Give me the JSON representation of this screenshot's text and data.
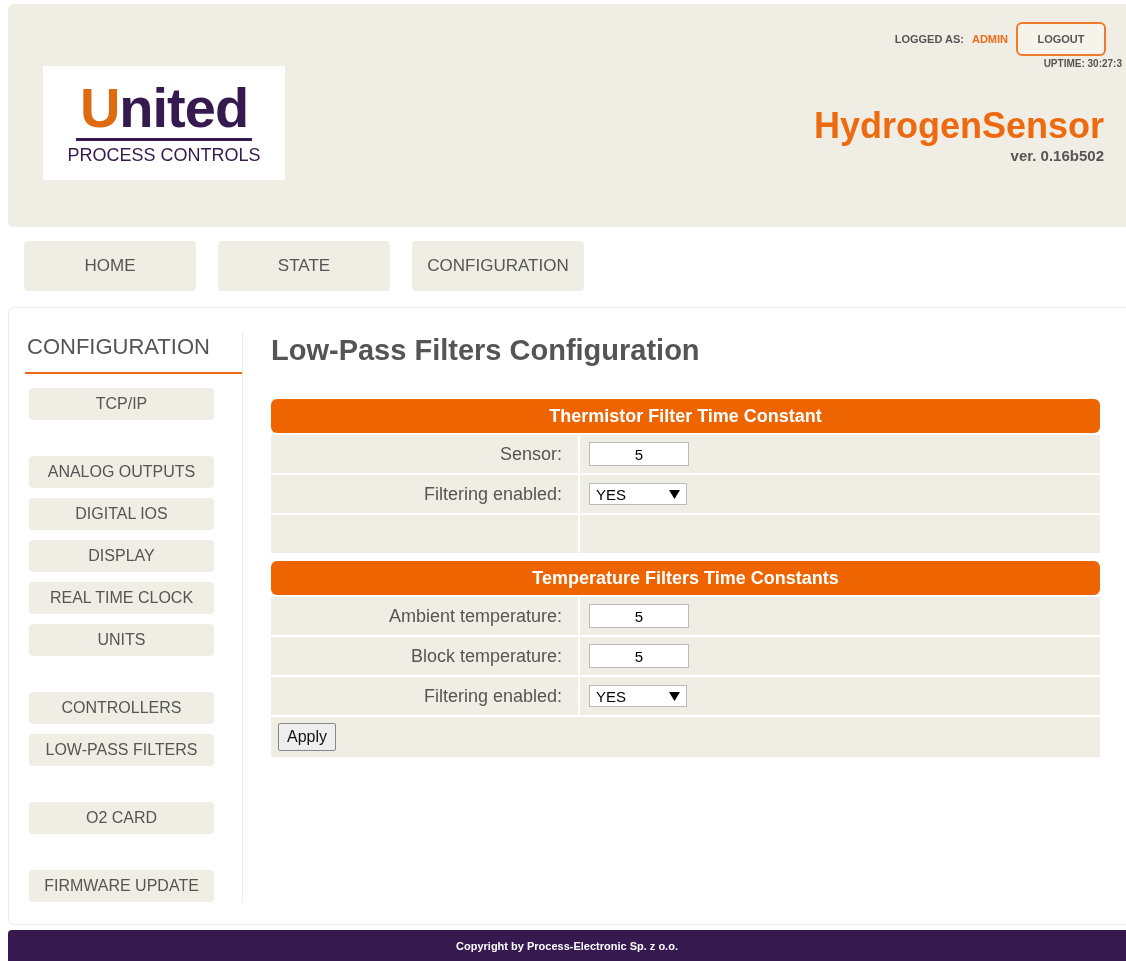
{
  "header": {
    "logo": {
      "name": "United",
      "tagline": "PROCESS CONTROLS"
    },
    "logged_label": "LOGGED AS:",
    "user": "ADMIN",
    "logout": "LOGOUT",
    "uptime": "UPTIME: 30:27:3",
    "product": "HydrogenSensor",
    "version": "ver. 0.16b502"
  },
  "nav": [
    {
      "label": "HOME"
    },
    {
      "label": "STATE"
    },
    {
      "label": "CONFIGURATION"
    }
  ],
  "sidebar": {
    "title": "CONFIGURATION",
    "groups": [
      {
        "items": [
          "TCP/IP"
        ]
      },
      {
        "items": [
          "ANALOG OUTPUTS",
          "DIGITAL IOS",
          "DISPLAY",
          "REAL TIME CLOCK",
          "UNITS"
        ]
      },
      {
        "items": [
          "CONTROLLERS",
          "LOW-PASS FILTERS"
        ]
      },
      {
        "items": [
          "O2 CARD"
        ]
      },
      {
        "items": [
          "FIRMWARE UPDATE"
        ]
      }
    ]
  },
  "title": "Low-Pass Filters Configuration",
  "sections": [
    {
      "heading": "Thermistor Filter Time Constant",
      "rows": [
        {
          "kind": "input",
          "label": "Sensor:",
          "value": "5"
        },
        {
          "kind": "select",
          "label": "Filtering enabled:",
          "value": "YES"
        },
        {
          "kind": "blank"
        }
      ]
    },
    {
      "heading": "Temperature Filters Time Constants",
      "rows": [
        {
          "kind": "input",
          "label": "Ambient temperature:",
          "value": "5"
        },
        {
          "kind": "input",
          "label": "Block temperature:",
          "value": "5"
        },
        {
          "kind": "select",
          "label": "Filtering enabled:",
          "value": "YES"
        }
      ]
    }
  ],
  "apply": "Apply",
  "footer": "Copyright by Process-Electronic Sp. z o.o."
}
